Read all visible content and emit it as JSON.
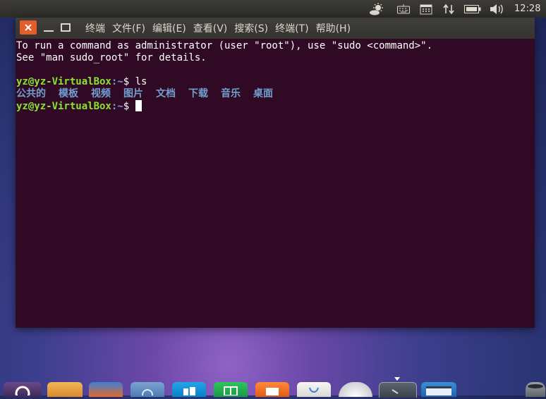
{
  "top_panel": {
    "clock": "12:28",
    "indicators": [
      "weather-icon",
      "keyboard-icon",
      "calendar-icon",
      "network-updown-icon",
      "battery-icon",
      "volume-icon"
    ]
  },
  "window": {
    "menu": [
      "终端",
      "文件(F)",
      "编辑(E)",
      "查看(V)",
      "搜索(S)",
      "终端(T)",
      "帮助(H)"
    ],
    "terminal": {
      "intro_line1": "To run a command as administrator (user \"root\"), use \"sudo <command>\".",
      "intro_line2": "See \"man sudo_root\" for details.",
      "prompt_user": "yz@yz-VirtualBox",
      "prompt_path": ":~",
      "prompt_symbol": "$ ",
      "command": "ls",
      "ls_output": [
        "公共的",
        "模板",
        "视频",
        "图片",
        "文档",
        "下载",
        "音乐",
        "桌面"
      ]
    }
  },
  "colors": {
    "terminal_bg": "#300a24",
    "prompt_user": "#8ae234",
    "directory": "#729fcf",
    "close_button": "#e65d2c"
  },
  "dock": {
    "items": [
      "ubuntu-launcher-icon",
      "files-folder-icon",
      "firefox-icon",
      "app-icon-blue",
      "windows-store-icon",
      "spreadsheet-icon",
      "presentation-icon",
      "text-editor-icon",
      "disk-icon",
      "terminal-icon",
      "window-app-icon",
      "trash-icon"
    ]
  }
}
